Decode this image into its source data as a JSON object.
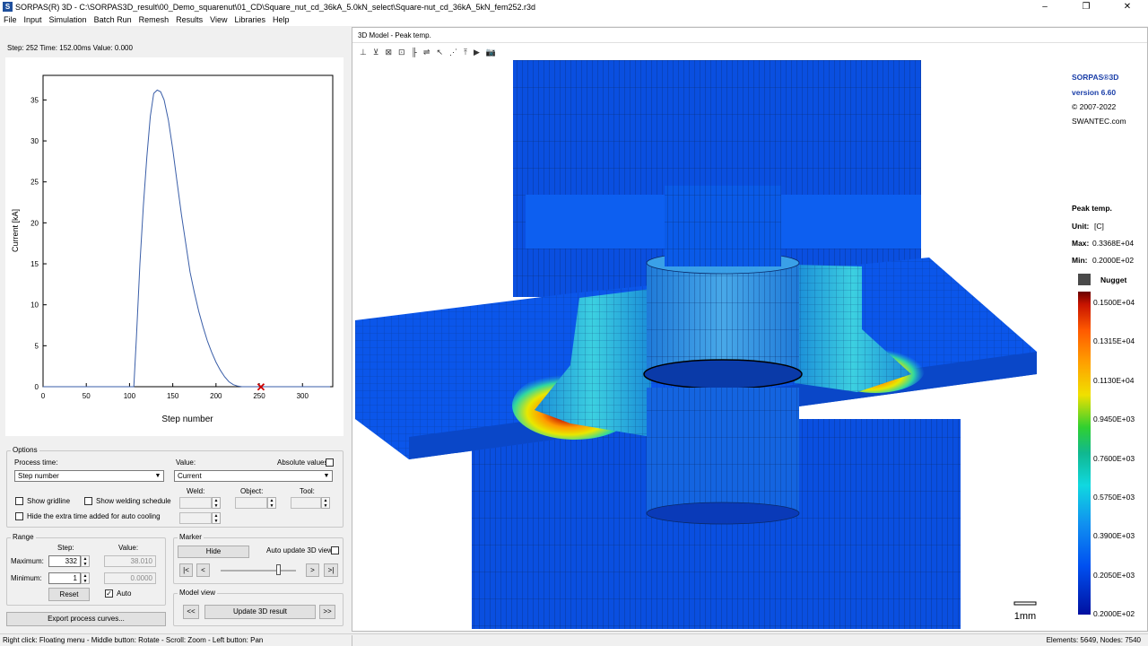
{
  "window": {
    "title": "SORPAS(R) 3D - C:\\SORPAS3D_result\\00_Demo_squarenut\\01_CD\\Square_nut_cd_36kA_5.0kN_select\\Square-nut_cd_36kA_5kN_fem252.r3d",
    "app_icon_label": "S",
    "minimize": "–",
    "maximize": "❐",
    "close": "✕"
  },
  "menu": [
    "File",
    "Input",
    "Simulation",
    "Batch Run",
    "Remesh",
    "Results",
    "View",
    "Libraries",
    "Help"
  ],
  "step_info": "Step: 252   Time: 152.00ms   Value: 0.000",
  "chart_data": {
    "type": "line",
    "xlabel": "Step number",
    "ylabel": "Current [kA]",
    "xlim": [
      0,
      335
    ],
    "ylim": [
      0,
      38
    ],
    "xticks": [
      0,
      50,
      100,
      150,
      200,
      250,
      300
    ],
    "yticks": [
      0,
      5,
      10,
      15,
      20,
      25,
      30,
      35
    ],
    "series": [
      {
        "x": [
          0,
          105,
          108,
          112,
          116,
          120,
          124,
          128,
          132,
          136,
          140,
          145,
          150,
          155,
          160,
          165,
          170,
          175,
          180,
          185,
          190,
          195,
          200,
          205,
          210,
          215,
          220,
          225,
          230,
          235,
          240,
          245,
          250,
          260,
          300,
          332
        ],
        "values": [
          0,
          0,
          6,
          15,
          22,
          28,
          33,
          35.8,
          36.2,
          36.0,
          35.0,
          32.5,
          29,
          25,
          21,
          17.5,
          14,
          11.5,
          9.2,
          7.3,
          5.6,
          4.2,
          3.0,
          2.0,
          1.2,
          0.6,
          0.25,
          0.08,
          0,
          0,
          0,
          0,
          0,
          0,
          0,
          0
        ]
      }
    ],
    "marker": {
      "x": 252,
      "y": 0,
      "symbol": "✕",
      "color": "#cc0000"
    },
    "line_color": "#3a5ea8"
  },
  "options": {
    "title": "Options",
    "process_time_label": "Process time:",
    "process_time_value": "Step number",
    "value_label": "Value:",
    "value_value": "Current",
    "absolute_values": "Absolute values",
    "show_gridline": "Show gridline",
    "show_welding_schedule": "Show welding schedule",
    "hide_extra_time": "Hide the extra time added for auto cooling",
    "weld_label": "Weld:",
    "object_label": "Object:",
    "tool_label": "Tool:"
  },
  "range": {
    "title": "Range",
    "step_label": "Step:",
    "value_label": "Value:",
    "maximum_label": "Maximum:",
    "minimum_label": "Minimum:",
    "max_step": "332",
    "min_step": "1",
    "max_value": "38.010",
    "min_value": "0.0000",
    "reset": "Reset",
    "auto": "Auto",
    "auto_checked": "✓"
  },
  "marker": {
    "title": "Marker",
    "hide": "Hide",
    "auto_update": "Auto update 3D view",
    "first": "|<",
    "prev": "<",
    "next": ">",
    "last": ">|",
    "position": 0.76
  },
  "model_view": {
    "title": "Model view",
    "back": "<<",
    "update": "Update 3D result",
    "fwd": ">>"
  },
  "export_button": "Export process curves...",
  "status": {
    "left": "Right click: Floating menu  -  Middle button: Rotate  -  Scroll: Zoom  -  Left button: Pan",
    "right": "Elements: 5649,  Nodes: 7540"
  },
  "model_window": {
    "title": "3D Model - Peak temp.",
    "toolbar": [
      "⊥",
      "⊻",
      "⊠",
      "⊡",
      "╟",
      "⇌",
      "↖",
      "⋰",
      "⤒",
      "▶",
      "📷"
    ],
    "scale_label": "1mm"
  },
  "legend": {
    "brand": "SORPAS®3D",
    "version": "version 6.60",
    "copyright": "© 2007-2022",
    "site": "SWANTEC.com",
    "quantity": "Peak temp.",
    "unit_label": "Unit:",
    "unit": "[C]",
    "max_label": "Max:",
    "max": "0.3368E+04",
    "min_label": "Min:",
    "min": "0.2000E+02",
    "nugget": "Nugget",
    "nugget_color": "#4a4a4a",
    "levels": [
      "0.1500E+04",
      "0.1315E+04",
      "0.1130E+04",
      "0.9450E+03",
      "0.7600E+03",
      "0.5750E+03",
      "0.3900E+03",
      "0.2050E+03",
      "0.2000E+02"
    ]
  }
}
